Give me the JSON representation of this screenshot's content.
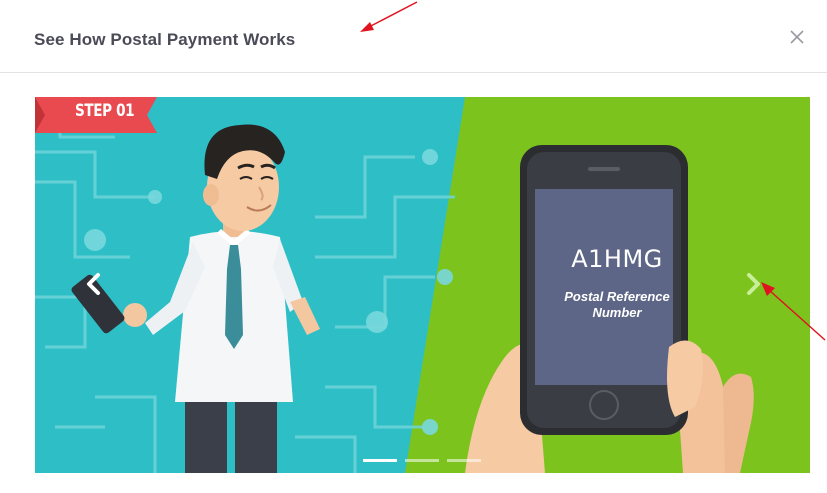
{
  "modal": {
    "title": "See How Postal Payment Works",
    "close_icon": "close-icon"
  },
  "carousel": {
    "step_label": "STEP 01",
    "reference_code": "A1HMG",
    "reference_caption": "Postal Reference Number",
    "prev_icon": "chevron-left-icon",
    "next_icon": "chevron-right-icon",
    "slide_count": 3,
    "active_slide": 1,
    "colors": {
      "left_bg": "#2ebfc6",
      "right_bg": "#7cc31e",
      "ribbon": "#e84a4f",
      "phone_screen": "#5d6686"
    }
  },
  "annotations": {
    "arrow_color": "#e0141e"
  }
}
